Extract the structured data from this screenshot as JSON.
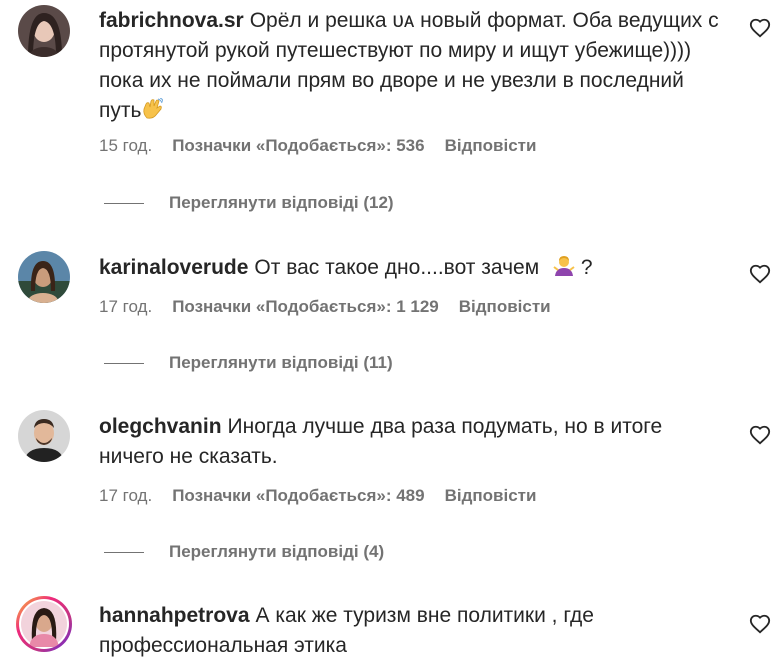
{
  "comments": [
    {
      "username": "fabrichnova.sr",
      "text": "Орёл и решка ᴜᴀ новый формат. Оба ведущих с протянутой рукой путешествуют по миру и ищут убежище)))) пока их не поймали прям во дворе и не увезли в последний путь",
      "emoji": "waving-hand",
      "time": "15 год.",
      "likes": "Позначки «Подобається»: 536",
      "reply": "Відповісти",
      "view_replies": "Переглянути відповіді (12)"
    },
    {
      "username": "karinaloverude",
      "text": "От вас такое дно....вот зачем",
      "emoji": "person-shrugging",
      "text_after": "?",
      "time": "17 год.",
      "likes": "Позначки «Подобається»: 1 129",
      "reply": "Відповісти",
      "view_replies": "Переглянути відповіді (11)"
    },
    {
      "username": "olegchvanin",
      "text": "Иногда лучше два раза подумать, но в итоге ничего не сказать.",
      "time": "17 год.",
      "likes": "Позначки «Подобається»: 489",
      "reply": "Відповісти",
      "view_replies": "Переглянути відповіді (4)"
    },
    {
      "username": "hannahpetrova",
      "text": "А как же туризм вне политики , где профессиональная этика"
    }
  ],
  "colors": {
    "text": "#262626",
    "secondary": "#737373",
    "story_ring": "#ee2a7b"
  }
}
